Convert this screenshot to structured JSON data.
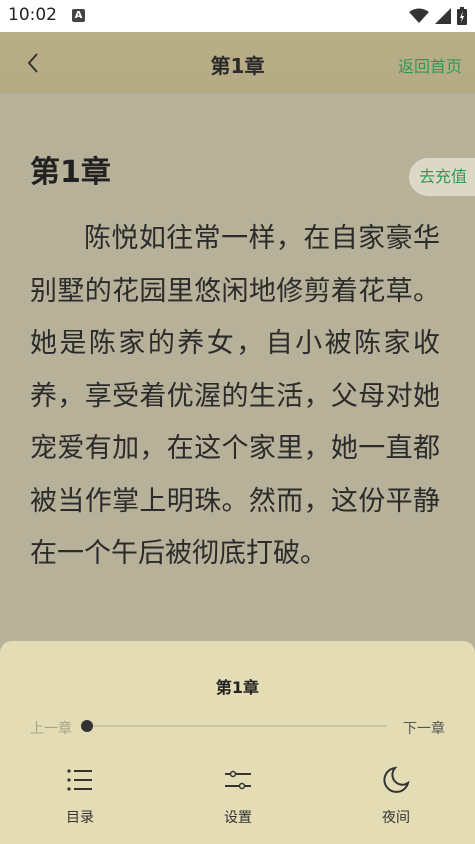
{
  "status_bar": {
    "time": "10:02",
    "notification_badge": "A"
  },
  "header": {
    "title": "第1章",
    "home_label": "返回首页"
  },
  "reader": {
    "chapter_heading": "第1章",
    "recharge_label": "去充值",
    "paragraphs": [
      "陈悦如往常一样，在自家豪华别墅的花园里悠闲地修剪着花草。她是陈家的养女，自小被陈家收养，享受着优渥的生活，父母对她宠爱有加，在这个家里，她一直都被当作掌上明珠。然而，这份平静在一个午后被彻底打破。"
    ]
  },
  "bottom_panel": {
    "chapter_title": "第1章",
    "prev_label": "上一章",
    "next_label": "下一章",
    "progress": 0,
    "tools": [
      {
        "label": "目录",
        "icon": "list-icon"
      },
      {
        "label": "设置",
        "icon": "sliders-icon"
      },
      {
        "label": "夜间",
        "icon": "moon-icon"
      }
    ]
  },
  "colors": {
    "header_bg": "#b8ad86",
    "reader_bg": "#b7b19a",
    "panel_bg": "#e3dcb5",
    "accent": "#2f9a58"
  }
}
